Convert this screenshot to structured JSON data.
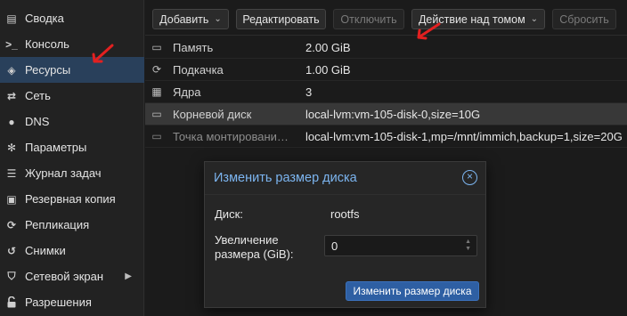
{
  "sidebar": {
    "items": [
      {
        "label": "Сводка",
        "icon": "summary-icon",
        "glyph": "▤"
      },
      {
        "label": "Консоль",
        "icon": "terminal-icon",
        "glyph": ">_"
      },
      {
        "label": "Ресурсы",
        "icon": "cube-icon",
        "glyph": "◈"
      },
      {
        "label": "Сеть",
        "icon": "network-arrows-icon",
        "glyph": "⇄"
      },
      {
        "label": "DNS",
        "icon": "globe-icon",
        "glyph": "●"
      },
      {
        "label": "Параметры",
        "icon": "gear-icon",
        "glyph": "✻"
      },
      {
        "label": "Журнал задач",
        "icon": "list-icon",
        "glyph": "☰"
      },
      {
        "label": "Резервная копия",
        "icon": "floppy-icon",
        "glyph": "▣"
      },
      {
        "label": "Репликация",
        "icon": "replication-icon",
        "glyph": "⟳"
      },
      {
        "label": "Снимки",
        "icon": "history-icon",
        "glyph": "↺"
      },
      {
        "label": "Сетевой экран",
        "icon": "shield-icon",
        "glyph": "⛉"
      },
      {
        "label": "Разрешения",
        "icon": "unlock-icon",
        "glyph": "🔓"
      }
    ]
  },
  "toolbar": {
    "add_label": "Добавить",
    "edit_label": "Редактировать",
    "detach_label": "Отключить",
    "volume_action_label": "Действие над томом",
    "reset_label": "Сбросить"
  },
  "resources": {
    "rows": [
      {
        "label": "Память",
        "value": "2.00 GiB",
        "icon": "memory-icon",
        "glyph": "▭",
        "dim": false
      },
      {
        "label": "Подкачка",
        "value": "1.00 GiB",
        "icon": "swap-icon",
        "glyph": "⟳",
        "dim": false
      },
      {
        "label": "Ядра",
        "value": "3",
        "icon": "cpu-icon",
        "glyph": "▦",
        "dim": false
      },
      {
        "label": "Корневой диск",
        "value": "local-lvm:vm-105-disk-0,size=10G",
        "icon": "disk-icon",
        "glyph": "▭",
        "dim": false
      },
      {
        "label": "Точка монтировани…",
        "value": "local-lvm:vm-105-disk-1,mp=/mnt/immich,backup=1,size=20G",
        "icon": "disk-icon",
        "glyph": "▭",
        "dim": true
      }
    ]
  },
  "dialog": {
    "title": "Изменить размер диска",
    "disk_label": "Диск:",
    "disk_value": "rootfs",
    "increase_label_line1": "Увеличение",
    "increase_label_line2": "размера (GiB):",
    "increase_value": "0",
    "submit_label": "Изменить размер диска"
  },
  "colors": {
    "accent": "#7cb5f0",
    "primary_button": "#2e5fa3",
    "selected_nav": "#29405b",
    "annotation": "#e32020"
  }
}
